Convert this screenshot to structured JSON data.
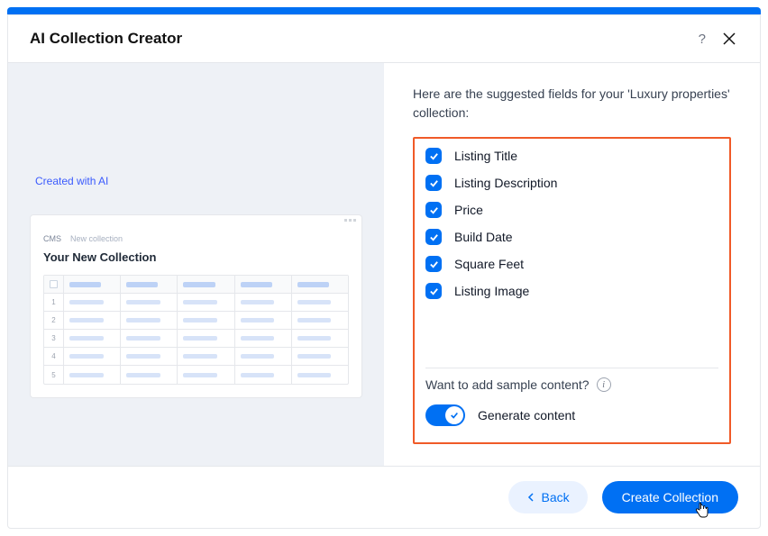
{
  "header": {
    "title": "AI Collection Creator"
  },
  "left": {
    "ai_badge": "Created with AI",
    "preview": {
      "breadcrumb_cms": "CMS",
      "breadcrumb_new": "New collection",
      "title": "Your New Collection",
      "row_numbers": [
        "1",
        "2",
        "3",
        "4",
        "5"
      ]
    }
  },
  "right": {
    "intro": "Here are the suggested fields for your 'Luxury properties' collection:",
    "fields": [
      {
        "label": "Listing Title",
        "checked": true
      },
      {
        "label": "Listing Description",
        "checked": true
      },
      {
        "label": "Price",
        "checked": true
      },
      {
        "label": "Build Date",
        "checked": true
      },
      {
        "label": "Square Feet",
        "checked": true
      },
      {
        "label": "Listing Image",
        "checked": true
      }
    ],
    "sample_question": "Want to add sample content?",
    "toggle_label": "Generate content",
    "toggle_on": true
  },
  "footer": {
    "back": "Back",
    "create": "Create Collection"
  }
}
